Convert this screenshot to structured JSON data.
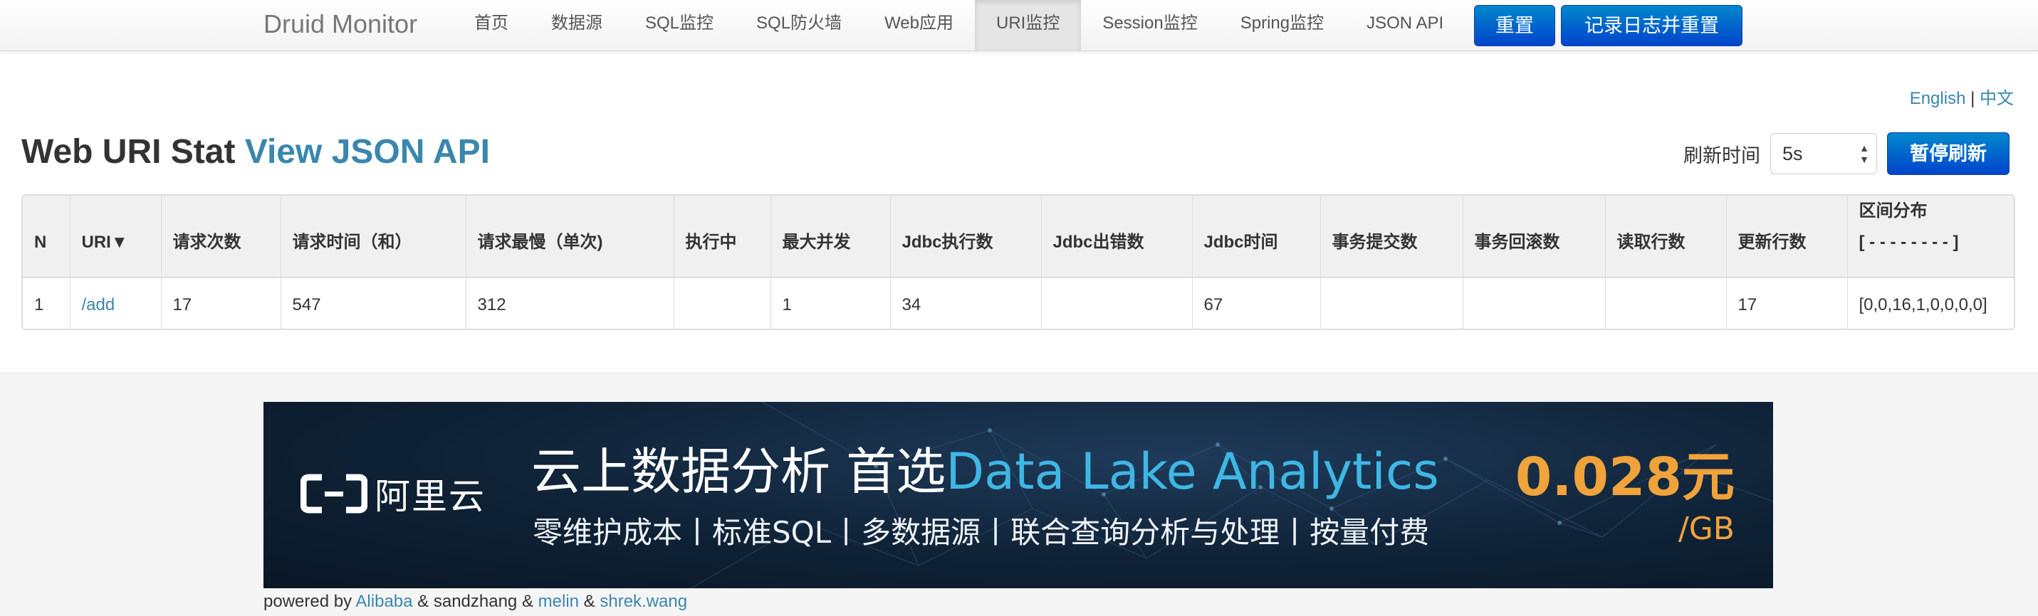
{
  "navbar": {
    "brand": "Druid Monitor",
    "items": [
      {
        "label": "首页",
        "active": false
      },
      {
        "label": "数据源",
        "active": false
      },
      {
        "label": "SQL监控",
        "active": false
      },
      {
        "label": "SQL防火墙",
        "active": false
      },
      {
        "label": "Web应用",
        "active": false
      },
      {
        "label": "URI监控",
        "active": true
      },
      {
        "label": "Session监控",
        "active": false
      },
      {
        "label": "Spring监控",
        "active": false
      },
      {
        "label": "JSON API",
        "active": false
      }
    ],
    "reset_label": "重置",
    "log_reset_label": "记录日志并重置"
  },
  "lang": {
    "english": "English",
    "separator": "|",
    "chinese": "中文"
  },
  "page": {
    "title": "Web URI Stat",
    "json_link": "View JSON API"
  },
  "refresh": {
    "label": "刷新时间",
    "selected": "5s",
    "pause_label": "暂停刷新"
  },
  "table": {
    "columns": [
      "N",
      "URI▼",
      "请求次数",
      "请求时间（和）",
      "请求最慢（单次)",
      "执行中",
      "最大并发",
      "Jdbc执行数",
      "Jdbc出错数",
      "Jdbc时间",
      "事务提交数",
      "事务回滚数",
      "读取行数",
      "更新行数",
      "区间分布"
    ],
    "last_column_sub": "[ - - - - - - - - ]",
    "rows": [
      [
        "1",
        "/add",
        "17",
        "547",
        "312",
        "",
        "1",
        "34",
        "",
        "67",
        "",
        "",
        "",
        "17",
        "[0,0,16,1,0,0,0,0]"
      ]
    ]
  },
  "banner": {
    "logo_text": "阿里云",
    "headline": "云上数据分析 首选",
    "headline_accent": "Data Lake Analytics",
    "subline": "零维护成本丨标准SQL丨多数据源丨联合查询分析与处理丨按量付费",
    "price": "0.028元",
    "unit": "/GB"
  },
  "footer": {
    "powered_by": "powered by",
    "alibaba": "Alibaba",
    "amp1": "&",
    "sandzhang": "sandzhang",
    "amp2": "&",
    "melin": "melin",
    "amp3": "&",
    "shrek": "shrek.wang"
  },
  "colors": {
    "primary_button": "#0055cc",
    "link": "#3a87ad",
    "price": "#f0a33a",
    "banner_bg": "#0f2236"
  }
}
